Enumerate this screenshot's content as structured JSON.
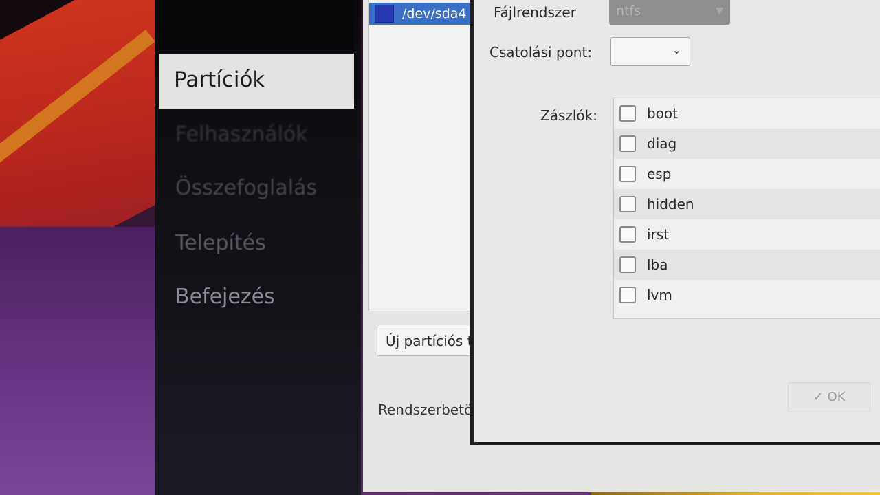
{
  "sidebar": {
    "steps": [
      {
        "label": "Partíciók",
        "state": "active"
      },
      {
        "label": "Felhasználók",
        "state": "pending"
      },
      {
        "label": "Összefoglalás",
        "state": "pending"
      },
      {
        "label": "Telepítés",
        "state": "pending"
      },
      {
        "label": "Befejezés",
        "state": "pending"
      }
    ]
  },
  "partition_list": {
    "selected_device": "/dev/sda4",
    "selected_color": "#2a3ab0"
  },
  "main": {
    "new_table_button": "Új partíciós tábla",
    "bootloader_label": "Rendszerbetöltő"
  },
  "dialog": {
    "filesystem_label": "Fájlrendszer",
    "filesystem_value": "ntfs",
    "mountpoint_label": "Csatolási pont:",
    "mountpoint_value": "",
    "flags_label": "Zászlók:",
    "flags": [
      {
        "name": "boot",
        "checked": false
      },
      {
        "name": "diag",
        "checked": false
      },
      {
        "name": "esp",
        "checked": false
      },
      {
        "name": "hidden",
        "checked": false
      },
      {
        "name": "irst",
        "checked": false
      },
      {
        "name": "lba",
        "checked": false
      },
      {
        "name": "lvm",
        "checked": false
      }
    ],
    "ok_label": "OK"
  },
  "icons": {
    "dropdown": "chevron-down-icon",
    "ok": "checkmark-icon"
  }
}
